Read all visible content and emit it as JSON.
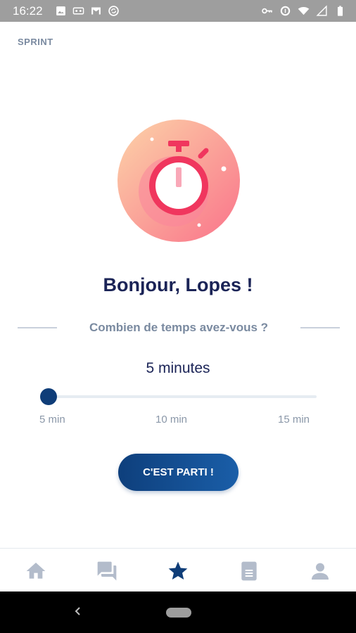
{
  "status_bar": {
    "time": "16:22"
  },
  "header": {
    "section_label": "SPRINT"
  },
  "illustration": {
    "icon": "stopwatch-icon"
  },
  "greeting": "Bonjour, Lopes !",
  "question": "Combien de temps avez-vous ?",
  "duration": {
    "selected_label": "5 minutes",
    "slider_fraction": 0,
    "ticks": [
      "5 min",
      "10 min",
      "15 min"
    ]
  },
  "start_button": {
    "label": "C'EST PARTI !"
  },
  "bottom_nav": {
    "items": [
      {
        "icon": "home-icon",
        "active": false
      },
      {
        "icon": "chat-icon",
        "active": false
      },
      {
        "icon": "star-icon",
        "active": true
      },
      {
        "icon": "book-icon",
        "active": false
      },
      {
        "icon": "profile-icon",
        "active": false
      }
    ]
  },
  "colors": {
    "primary": "#0f3d78",
    "title": "#1b2457",
    "muted": "#7a8aa0",
    "accent": "#f0365e",
    "nav_inactive": "#b3bccb"
  }
}
